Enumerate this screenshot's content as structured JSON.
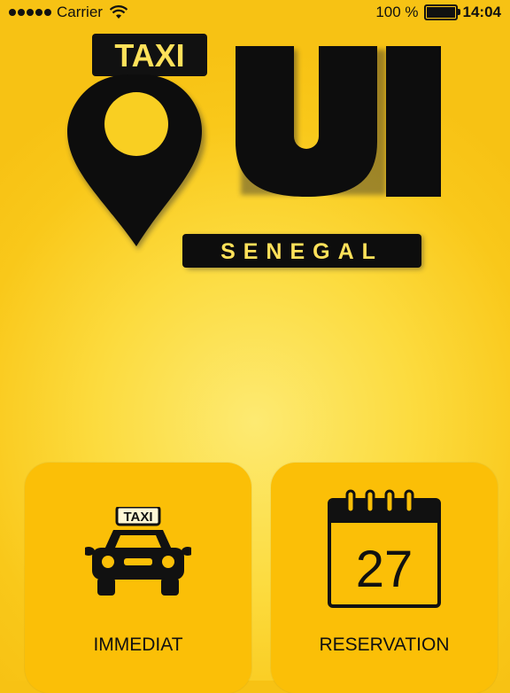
{
  "status_bar": {
    "carrier": "Carrier",
    "battery": "100 %",
    "battery_level": 1.0,
    "time": "14:04"
  },
  "logo": {
    "taxi": "TAXI",
    "oui": "UI",
    "country": "SENEGAL"
  },
  "actions": {
    "immediat_label": "IMMEDIAT",
    "reservation_label": "RESERVATION",
    "taxi_sign": "TAXI",
    "calendar_day": "27"
  },
  "colors": {
    "background": "#fcdb3e",
    "tile": "#fbbf07",
    "dark": "#111111"
  }
}
